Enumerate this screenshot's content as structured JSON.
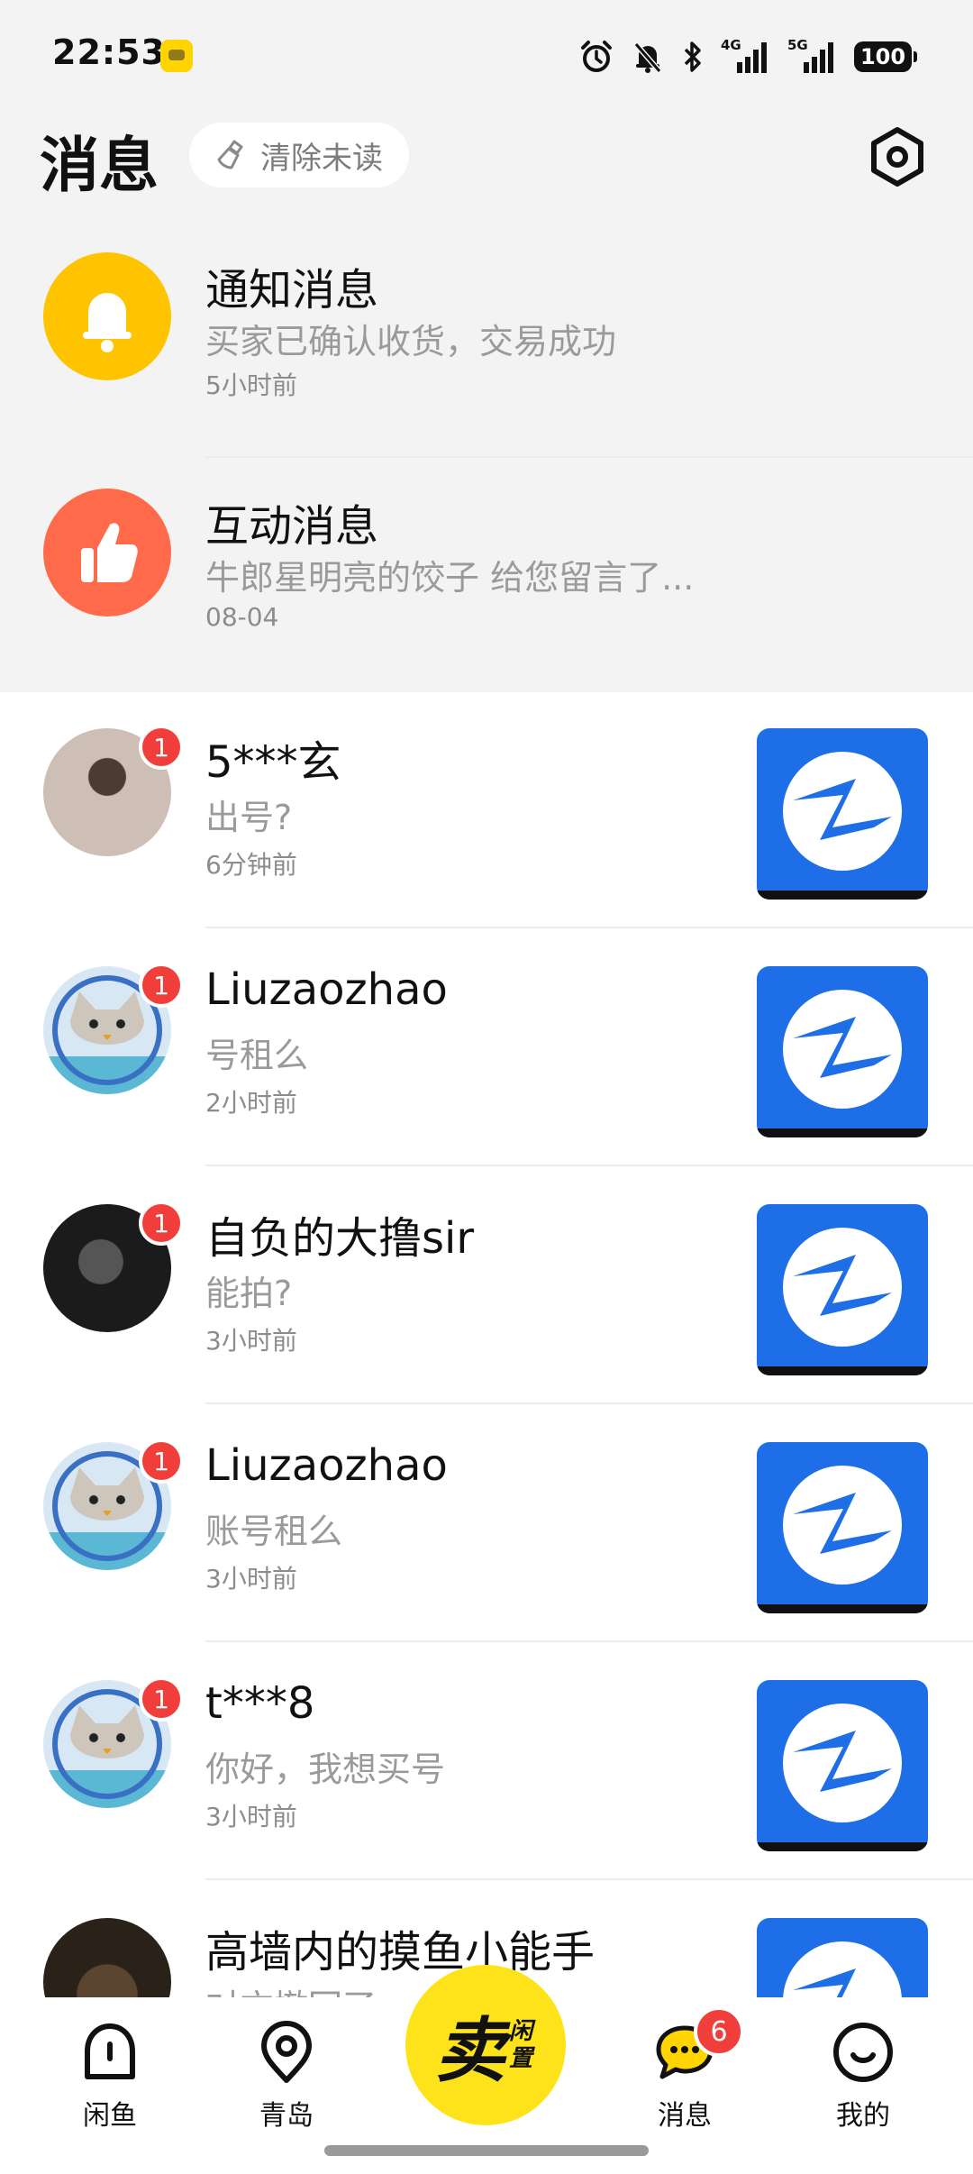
{
  "status_bar": {
    "time": "22:53",
    "net_4g": "4G",
    "net_5g": "5G",
    "battery": "100"
  },
  "header": {
    "title": "消息",
    "clear_unread_label": "清除未读"
  },
  "system_messages": [
    {
      "title": "通知消息",
      "preview": "买家已确认收货，交易成功",
      "time": "5小时前",
      "icon": "bell-icon",
      "color": "#ffc400"
    },
    {
      "title": "互动消息",
      "preview": "牛郎星明亮的饺子 给您留言了...",
      "time": "08-04",
      "icon": "thumbs-up-icon",
      "color": "#ff6b4a"
    }
  ],
  "conversations": [
    {
      "name": "5***玄",
      "preview": "出号?",
      "time": "6分钟前",
      "badge": "1"
    },
    {
      "name": "Liuzaozhao",
      "preview": "号租么",
      "time": "2小时前",
      "badge": "1"
    },
    {
      "name": "自负的大撸sir",
      "preview": "能拍?",
      "time": "3小时前",
      "badge": "1"
    },
    {
      "name": "Liuzaozhao",
      "preview": "账号租么",
      "time": "3小时前",
      "badge": "1"
    },
    {
      "name": "t***8",
      "preview": "你好，我想买号",
      "time": "3小时前",
      "badge": "1"
    },
    {
      "name": "高墙内的摸鱼小能手",
      "preview": "对方撤回了",
      "time": "",
      "badge": ""
    }
  ],
  "bottom_nav": {
    "home": "闲鱼",
    "city": "青岛",
    "sell_main": "卖",
    "sell_sub": "闲置",
    "messages": "消息",
    "messages_badge": "6",
    "profile": "我的"
  },
  "colors": {
    "accent_yellow": "#ffe31a",
    "badge_red": "#f03f3a",
    "thumb_blue": "#1e6ee8"
  }
}
